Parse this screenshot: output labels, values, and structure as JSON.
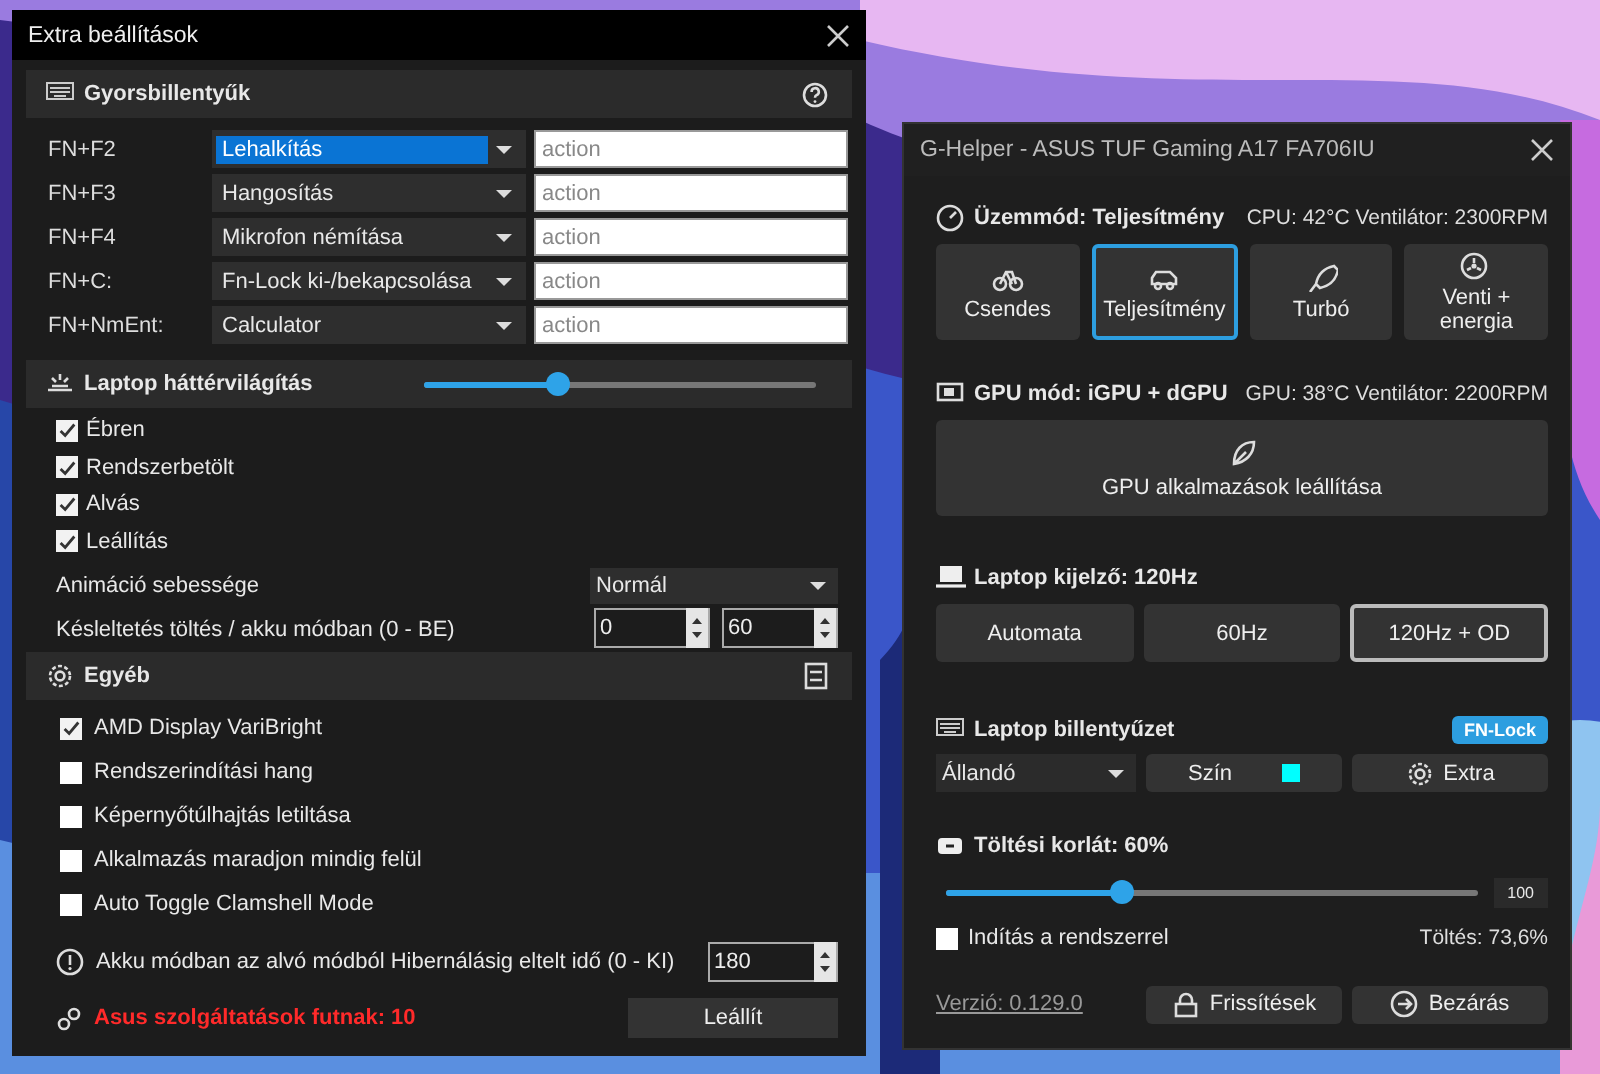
{
  "extra_window": {
    "title": "Extra beállítások",
    "hotkeys": {
      "title": "Gyorsbillentyűk",
      "rows": [
        {
          "key": "FN+F2",
          "action": "Lehalkítás",
          "selected": true,
          "placeholder": "action"
        },
        {
          "key": "FN+F3",
          "action": "Hangosítás",
          "selected": false,
          "placeholder": "action"
        },
        {
          "key": "FN+F4",
          "action": "Mikrofon némítása",
          "selected": false,
          "placeholder": "action"
        },
        {
          "key": "FN+C:",
          "action": "Fn-Lock ki-/bekapcsolása",
          "selected": false,
          "placeholder": "action"
        },
        {
          "key": "FN+NmEnt:",
          "action": "Calculator",
          "selected": false,
          "placeholder": "action"
        }
      ]
    },
    "backlight": {
      "title": "Laptop háttérvilágítás",
      "level": 0.34,
      "options": [
        {
          "label": "Ébren",
          "checked": true
        },
        {
          "label": "Rendszerbetölt",
          "checked": true
        },
        {
          "label": "Alvás",
          "checked": true
        },
        {
          "label": "Leállítás",
          "checked": true
        }
      ],
      "animation": {
        "label": "Animáció sebessége",
        "value": "Normál"
      },
      "timeout": {
        "label": "Késleltetés töltés / akku módban (0 - BE)",
        "values": [
          "0",
          "60"
        ]
      }
    },
    "other": {
      "title": "Egyéb",
      "options": [
        {
          "label": "AMD Display VariBright",
          "checked": true
        },
        {
          "label": "Rendszerindítási hang",
          "checked": false
        },
        {
          "label": "Képernyőtúlhajtás letiltása",
          "checked": false
        },
        {
          "label": "Alkalmazás maradjon mindig felül",
          "checked": false
        },
        {
          "label": "Auto Toggle Clamshell Mode",
          "checked": false
        }
      ],
      "hibernate": {
        "label": "Akku módban az alvó módból Hibernálásig eltelt idő (0 - KI)",
        "value": "180"
      },
      "services": {
        "label": "Asus szolgáltatások futnak:  10",
        "button": "Leállít"
      }
    }
  },
  "ghelper": {
    "title": "G-Helper - ASUS TUF Gaming A17 FA706IU",
    "mode": {
      "title": "Üzemmód: Teljesítmény",
      "stats": "CPU: 42°C Ventilátor: 2300RPM",
      "buttons": [
        {
          "label": "Csendes",
          "selected": false
        },
        {
          "label": "Teljesítmény",
          "selected": true
        },
        {
          "label": "Turbó",
          "selected": false
        },
        {
          "label": "Venti + energia",
          "selected": false
        }
      ]
    },
    "gpu": {
      "title": "GPU mód: iGPU + dGPU",
      "stats": "GPU: 38°C Ventilátor: 2200RPM",
      "button": "GPU alkalmazások leállítása"
    },
    "display": {
      "title": "Laptop kijelző: 120Hz",
      "buttons": [
        {
          "label": "Automata",
          "selected": false
        },
        {
          "label": "60Hz",
          "selected": false
        },
        {
          "label": "120Hz + OD",
          "selected": true
        }
      ]
    },
    "keyboard": {
      "title": "Laptop billentyűzet",
      "badge": "FN-Lock",
      "mode": "Állandó",
      "color_button": "Szín",
      "color": "#00ffff",
      "extra_button": "Extra"
    },
    "charge": {
      "title": "Töltési korlát: 60%",
      "level": 0.33,
      "max": "100",
      "autostart": {
        "label": "Indítás a rendszerrel",
        "checked": false
      },
      "status": "Töltés: 73,6%"
    },
    "footer": {
      "version": "Verzió: 0.129.0",
      "updates": "Frissítések",
      "quit": "Bezárás"
    }
  }
}
